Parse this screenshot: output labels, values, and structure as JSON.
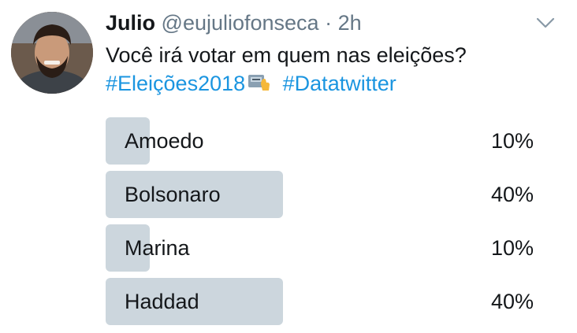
{
  "tweet": {
    "author_name": "Julio",
    "handle": "@eujuliofonseca",
    "separator": "·",
    "time": "2h",
    "text_line1": "Você irá votar em quem nas eleições?",
    "hashtags": [
      "#Eleições2018",
      "#Datatwitter"
    ],
    "emoji": "ballot-box-icon"
  },
  "poll": {
    "options": [
      {
        "label": "Amoedo",
        "percent_text": "10%",
        "percent": 10
      },
      {
        "label": "Bolsonaro",
        "percent_text": "40%",
        "percent": 40
      },
      {
        "label": "Marina",
        "percent_text": "10%",
        "percent": 10
      },
      {
        "label": "Haddad",
        "percent_text": "40%",
        "percent": 40
      }
    ]
  },
  "colors": {
    "bar": "#ccd6dd",
    "link": "#1b95e0",
    "secondary_text": "#657786"
  }
}
